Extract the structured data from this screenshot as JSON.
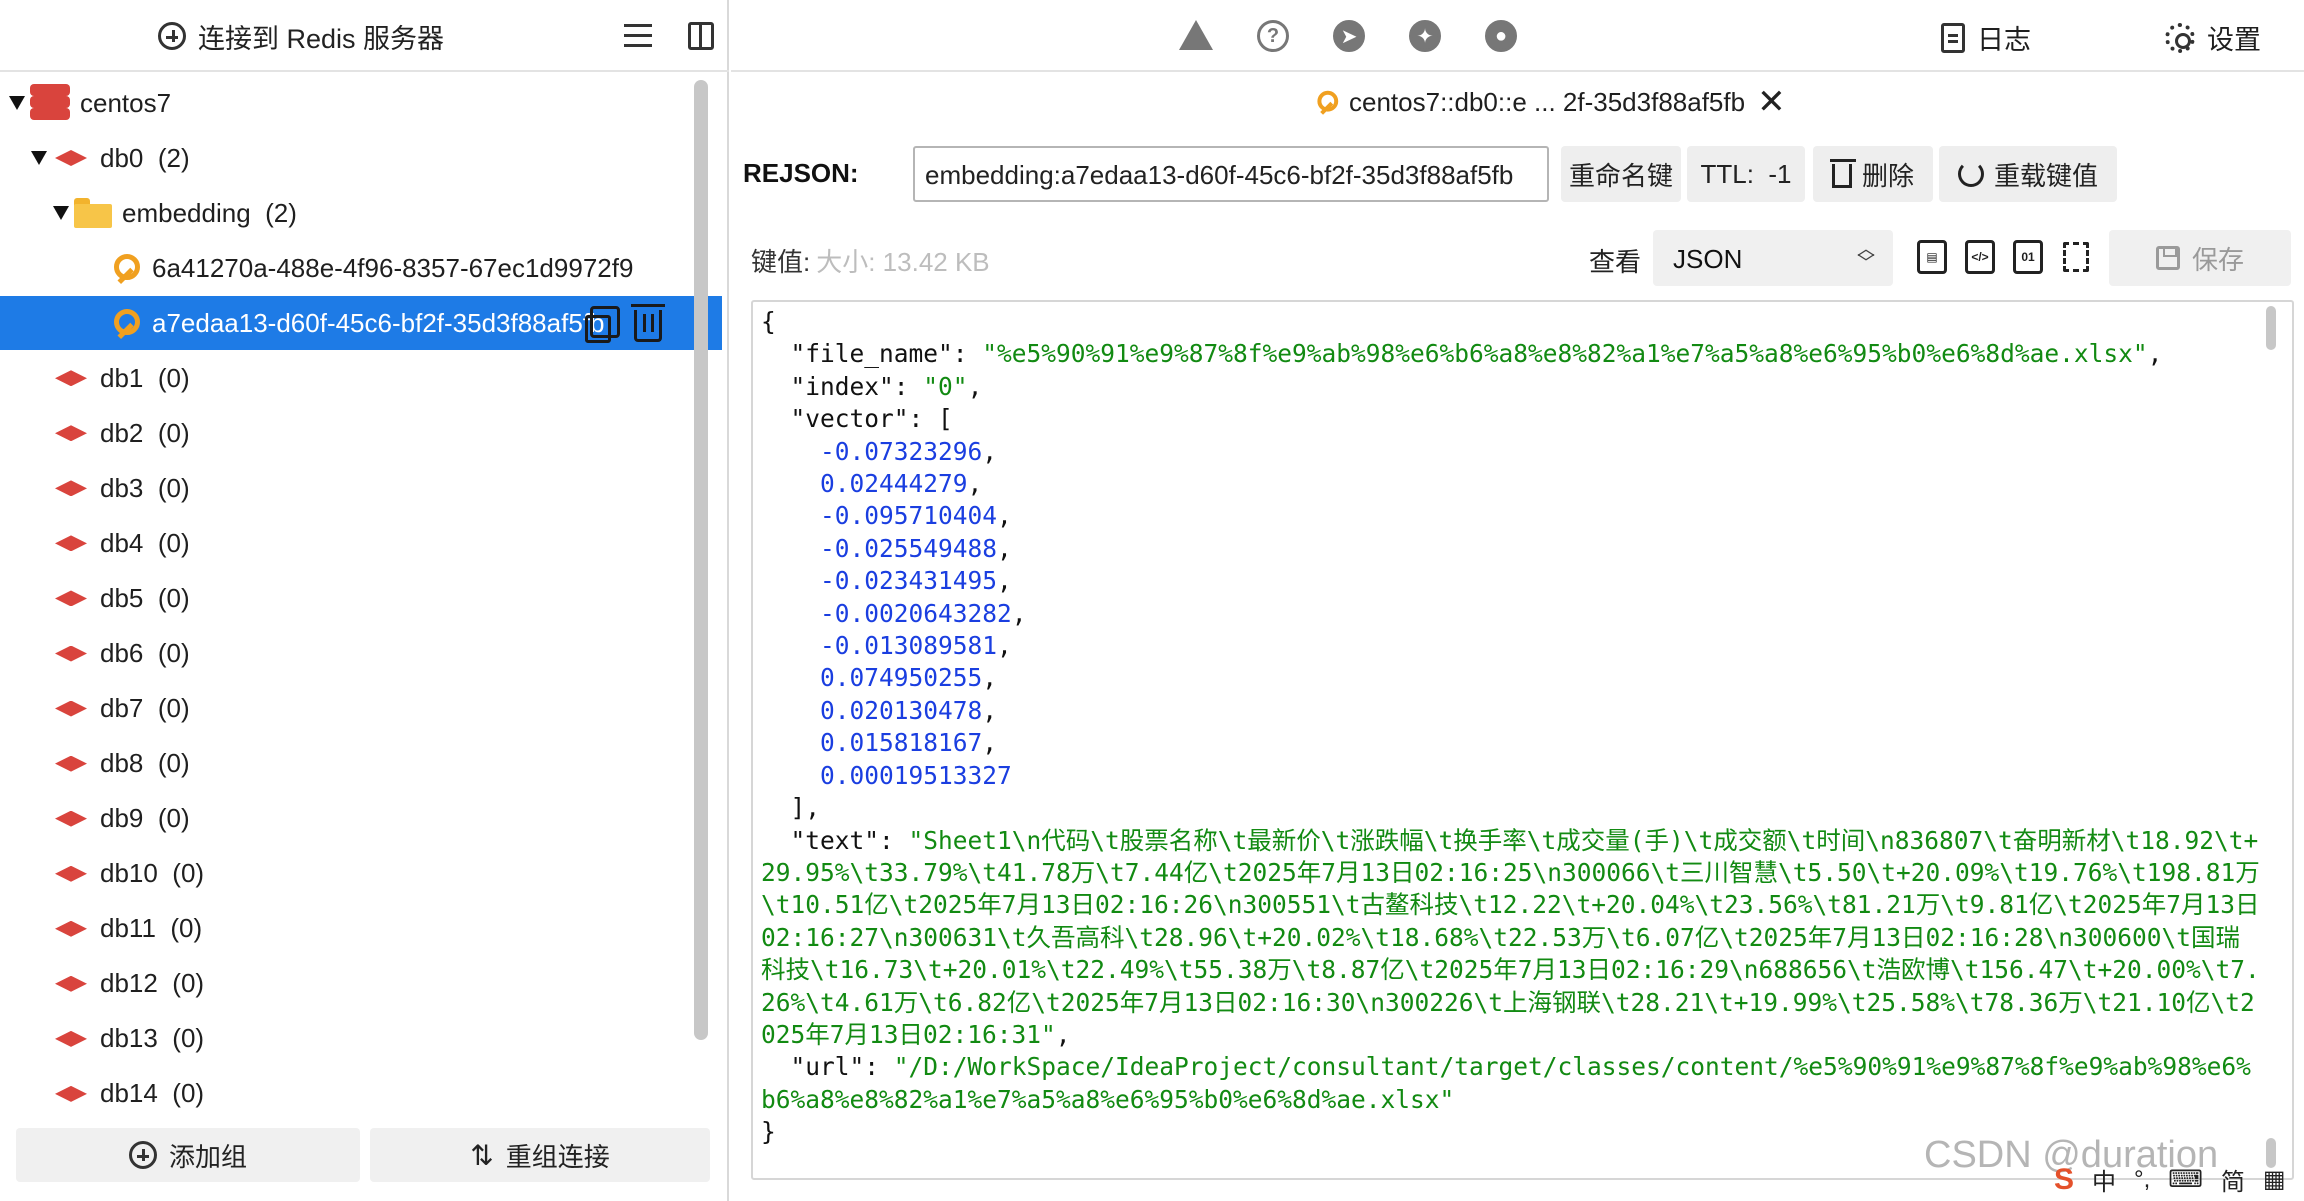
{
  "sidebar": {
    "connect_label": "连接到 Redis 服务器",
    "tree": [
      {
        "label": "centos7",
        "count": "",
        "kind": "server"
      },
      {
        "label": "db0",
        "count": "(2)",
        "kind": "db"
      },
      {
        "label": "embedding",
        "count": "(2)",
        "kind": "folder"
      },
      {
        "label": "6a41270a-488e-4f96-8357-67ec1d9972f9",
        "count": "",
        "kind": "key"
      },
      {
        "label": "a7edaa13-d60f-45c6-bf2f-35d3f88af5fb",
        "count": "",
        "kind": "key",
        "selected": true
      },
      {
        "label": "db1",
        "count": "(0)",
        "kind": "db"
      },
      {
        "label": "db2",
        "count": "(0)",
        "kind": "db"
      },
      {
        "label": "db3",
        "count": "(0)",
        "kind": "db"
      },
      {
        "label": "db4",
        "count": "(0)",
        "kind": "db"
      },
      {
        "label": "db5",
        "count": "(0)",
        "kind": "db"
      },
      {
        "label": "db6",
        "count": "(0)",
        "kind": "db"
      },
      {
        "label": "db7",
        "count": "(0)",
        "kind": "db"
      },
      {
        "label": "db8",
        "count": "(0)",
        "kind": "db"
      },
      {
        "label": "db9",
        "count": "(0)",
        "kind": "db"
      },
      {
        "label": "db10",
        "count": "(0)",
        "kind": "db"
      },
      {
        "label": "db11",
        "count": "(0)",
        "kind": "db"
      },
      {
        "label": "db12",
        "count": "(0)",
        "kind": "db"
      },
      {
        "label": "db13",
        "count": "(0)",
        "kind": "db"
      },
      {
        "label": "db14",
        "count": "(0)",
        "kind": "db"
      }
    ],
    "add_group_label": "添加组",
    "reorder_label": "重组连接"
  },
  "header": {
    "log_label": "日志",
    "settings_label": "设置"
  },
  "tab": {
    "title": "centos7::db0::e ... 2f-35d3f88af5fb"
  },
  "key_bar": {
    "type_label": "REJSON:",
    "key_name": "embedding:a7edaa13-d60f-45c6-bf2f-35d3f88af5fb",
    "rename_label": "重命名键",
    "ttl_label": "TTL:  -1",
    "delete_label": "删除",
    "reload_label": "重载键值"
  },
  "value_bar": {
    "value_label": "键值:",
    "size_text": "大小: 13.42 KB",
    "view_label": "查看",
    "view_format": "JSON",
    "save_label": "保存"
  },
  "json": {
    "file_name_key": "\"file_name\"",
    "file_name_val": "\"%e5%90%91%e9%87%8f%e9%ab%98%e6%b6%a8%e8%82%a1%e7%a5%a8%e6%95%b0%e6%8d%ae.xlsx\"",
    "index_key": "\"index\"",
    "index_val": "\"0\"",
    "vector_key": "\"vector\"",
    "vector": [
      "-0.07323296",
      "0.02444279",
      "-0.095710404",
      "-0.025549488",
      "-0.023431495",
      "-0.0020643282",
      "-0.013089581",
      "0.074950255",
      "0.020130478",
      "0.015818167",
      "0.00019513327"
    ],
    "text_key": "\"text\"",
    "text_val": "\"Sheet1\\n代码\\t股票名称\\t最新价\\t涨跌幅\\t换手率\\t成交量(手)\\t成交额\\t时间\\n836807\\t奋明新材\\t18.92\\t+29.95%\\t33.79%\\t41.78万\\t7.44亿\\t2025年7月13日02:16:25\\n300066\\t三川智慧\\t5.50\\t+20.09%\\t19.76%\\t198.81万\\t10.51亿\\t2025年7月13日02:16:26\\n300551\\t古鳌科技\\t12.22\\t+20.04%\\t23.56%\\t81.21万\\t9.81亿\\t2025年7月13日02:16:27\\n300631\\t久吾高科\\t28.96\\t+20.02%\\t18.68%\\t22.53万\\t6.07亿\\t2025年7月13日02:16:28\\n300600\\t国瑞科技\\t16.73\\t+20.01%\\t22.49%\\t55.38万\\t8.87亿\\t2025年7月13日02:16:29\\n688656\\t浩欧博\\t156.47\\t+20.00%\\t7.26%\\t4.61万\\t6.82亿\\t2025年7月13日02:16:30\\n300226\\t上海钢联\\t28.21\\t+19.99%\\t25.58%\\t78.36万\\t21.10亿\\t2025年7月13日02:16:31\"",
    "url_key": "\"url\"",
    "url_val": "\"/D:/WorkSpace/IdeaProject/consultant/target/classes/content/%e5%90%91%e9%87%8f%e9%ab%98%e6%b6%a8%e8%82%a1%e7%a5%a8%e6%95%b0%e6%8d%ae.xlsx\""
  },
  "watermark": "CSDN @duration",
  "ime": {
    "lang": "中",
    "mode": "简"
  }
}
